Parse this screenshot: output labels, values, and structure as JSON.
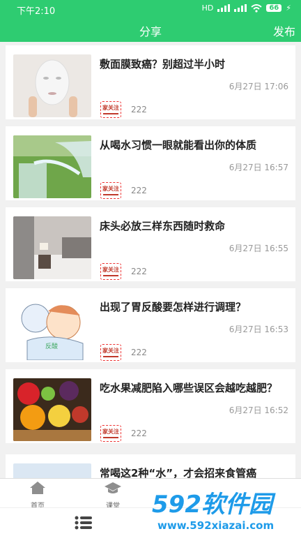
{
  "status": {
    "time": "下午2:10",
    "signal": "HD",
    "battery": "66"
  },
  "header": {
    "title": "分享",
    "publish_label": "发布"
  },
  "articles": [
    {
      "title": "敷面膜致癌？别超过半小时",
      "time": "6月27日 17:06",
      "source": "家关注",
      "count": "222",
      "thumb": "face-mask-photo"
    },
    {
      "title": "从喝水习惯一眼就能看出你的体质",
      "time": "6月27日 16:57",
      "source": "家关注",
      "count": "222",
      "thumb": "water-pouring-photo"
    },
    {
      "title": "床头必放三样东西随时救命",
      "time": "6月27日 16:55",
      "source": "家关注",
      "count": "222",
      "thumb": "bedroom-photo"
    },
    {
      "title": "出现了胃反酸要怎样进行调理？",
      "time": "6月27日 16:53",
      "source": "家关注",
      "count": "222",
      "thumb": "acid-reflux-illustration",
      "thumb_label": "反酸"
    },
    {
      "title": "吃水果减肥陷入哪些误区会越吃越肥？",
      "time": "6月27日 16:52",
      "source": "家关注",
      "count": "222",
      "thumb": "fruit-basket-photo"
    },
    {
      "title": "常喝这2种“水”，才会招来食管癌",
      "thumb": "sky-photo"
    }
  ],
  "tabs": [
    {
      "label": "首页",
      "icon": "home-icon"
    },
    {
      "label": "课堂",
      "icon": "graduation-cap-icon"
    }
  ],
  "watermark": {
    "brand": "592软件园",
    "url": "www.592xiazai.com"
  },
  "colors": {
    "accent": "#2ecc71",
    "watermark_blue": "#1e9be9"
  }
}
